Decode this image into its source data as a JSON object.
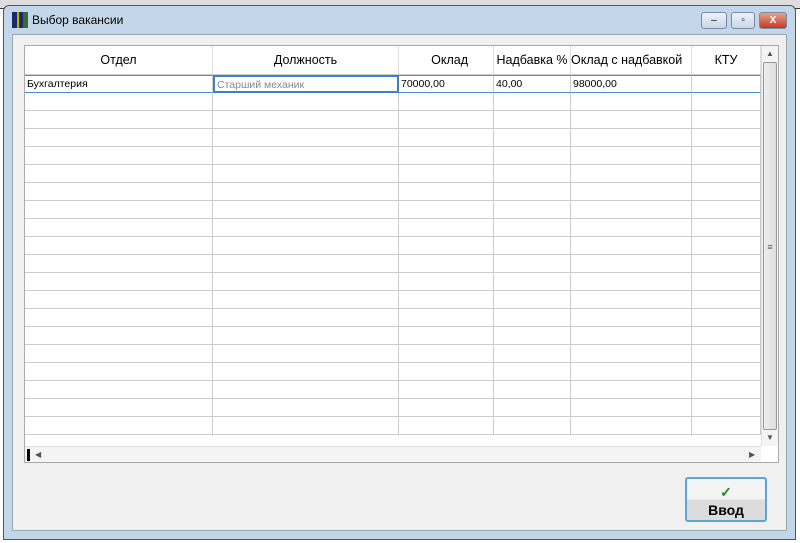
{
  "window": {
    "title": "Выбор вакансии",
    "minimize": "–",
    "maximize": "▫",
    "close": "X"
  },
  "grid": {
    "columns": [
      "Отдел",
      "Должность",
      "Оклад",
      "Надбавка %",
      "Оклад с надбавкой",
      "КТУ"
    ],
    "rows": [
      [
        "Бухгалтерия",
        "Старший механик",
        "70000,00",
        "40,00",
        "98000,00",
        ""
      ]
    ],
    "empty_rows": 19
  },
  "button": {
    "icon": "✓",
    "label": "Ввод"
  }
}
